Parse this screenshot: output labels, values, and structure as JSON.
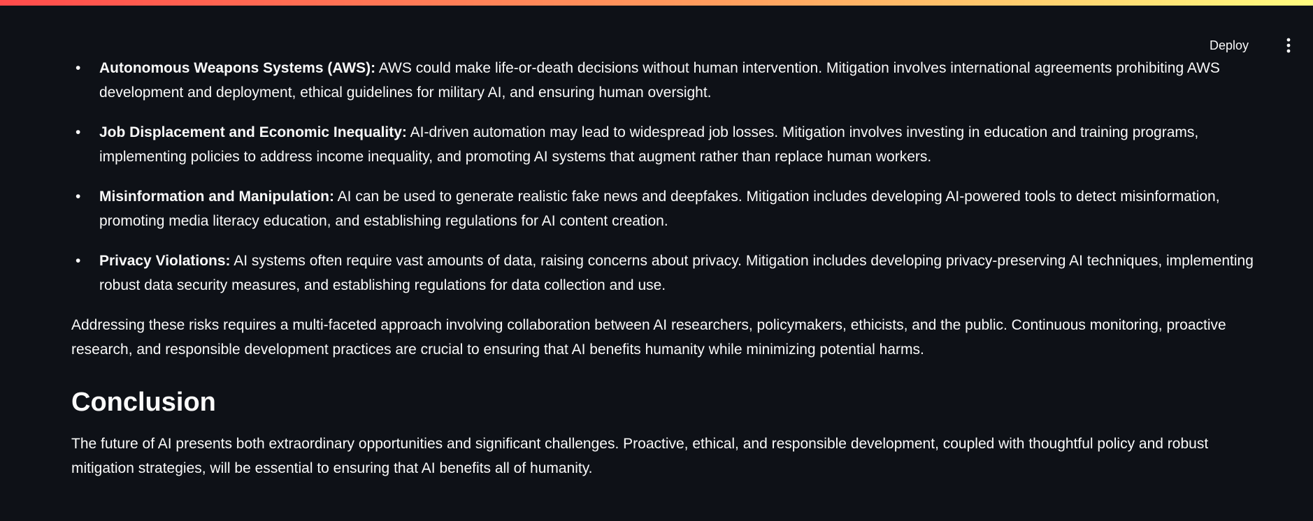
{
  "header": {
    "deploy_label": "Deploy",
    "menu_icon": "vertical-ellipsis-icon"
  },
  "risks": [
    {
      "term": "Autonomous Weapons Systems (AWS):",
      "text": " AWS could make life-or-death decisions without human intervention. Mitigation involves international agreements prohibiting AWS development and deployment, ethical guidelines for military AI, and ensuring human oversight."
    },
    {
      "term": "Job Displacement and Economic Inequality:",
      "text": " AI-driven automation may lead to widespread job losses. Mitigation involves investing in education and training programs, implementing policies to address income inequality, and promoting AI systems that augment rather than replace human workers."
    },
    {
      "term": "Misinformation and Manipulation:",
      "text": " AI can be used to generate realistic fake news and deepfakes. Mitigation includes developing AI-powered tools to detect misinformation, promoting media literacy education, and establishing regulations for AI content creation."
    },
    {
      "term": "Privacy Violations:",
      "text": " AI systems often require vast amounts of data, raising concerns about privacy. Mitigation includes developing privacy-preserving AI techniques, implementing robust data security measures, and establishing regulations for data collection and use."
    }
  ],
  "summary_paragraph": "Addressing these risks requires a multi-faceted approach involving collaboration between AI researchers, policymakers, ethicists, and the public. Continuous monitoring, proactive research, and responsible development practices are crucial to ensuring that AI benefits humanity while minimizing potential harms.",
  "conclusion": {
    "heading": "Conclusion",
    "text": "The future of AI presents both extraordinary opportunities and significant challenges. Proactive, ethical, and responsible development, coupled with thoughtful policy and robust mitigation strategies, will be essential to ensuring that AI benefits all of humanity."
  },
  "colors": {
    "background": "#0e1117",
    "text": "#fafafa",
    "accent_gradient_start": "#ff4b4b",
    "accent_gradient_end": "#fffd80"
  }
}
